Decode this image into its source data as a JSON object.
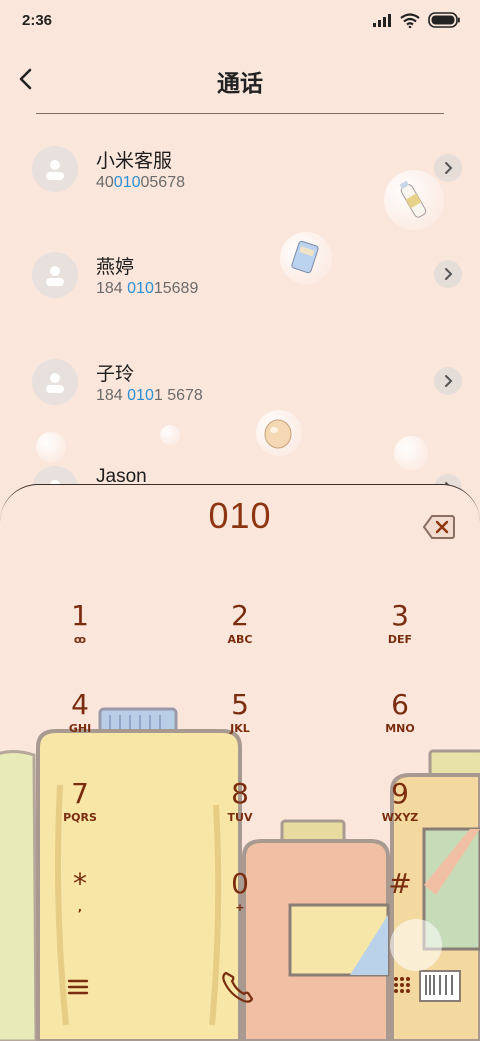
{
  "status": {
    "time": "2:36"
  },
  "header": {
    "title": "通话"
  },
  "contacts": [
    {
      "name": "小米客服",
      "num_pre": "40",
      "num_hl": "010",
      "num_post": "05678"
    },
    {
      "name": "燕婷",
      "num_pre": "184 ",
      "num_hl": "010",
      "num_post": "15689"
    },
    {
      "name": "子玲",
      "num_pre": "184 ",
      "num_hl": "010",
      "num_post": "1 5678"
    },
    {
      "name": "Jason",
      "num_pre": "",
      "num_hl": "",
      "num_post": ""
    }
  ],
  "dialer": {
    "input": "010",
    "keys": [
      {
        "n": "1",
        "l": "ꝏ"
      },
      {
        "n": "2",
        "l": "ABC"
      },
      {
        "n": "3",
        "l": "DEF"
      },
      {
        "n": "4",
        "l": "GHI"
      },
      {
        "n": "5",
        "l": "JKL"
      },
      {
        "n": "6",
        "l": "MNO"
      },
      {
        "n": "7",
        "l": "PQRS"
      },
      {
        "n": "8",
        "l": "TUV"
      },
      {
        "n": "9",
        "l": "WXYZ"
      },
      {
        "n": "*",
        "l": ","
      },
      {
        "n": "0",
        "l": "+"
      },
      {
        "n": "#",
        "l": ""
      }
    ]
  },
  "colors": {
    "accent": "#2a8fd3",
    "key": "#7a2d0e",
    "digits": "#8d3410",
    "background": "#fbe6dc"
  },
  "icons": [
    "back-arrow-icon",
    "signal-icon",
    "wifi-icon",
    "battery-icon",
    "person-icon",
    "chevron-right-icon",
    "delete-icon",
    "menu-icon",
    "phone-icon",
    "dialpad-icon"
  ]
}
